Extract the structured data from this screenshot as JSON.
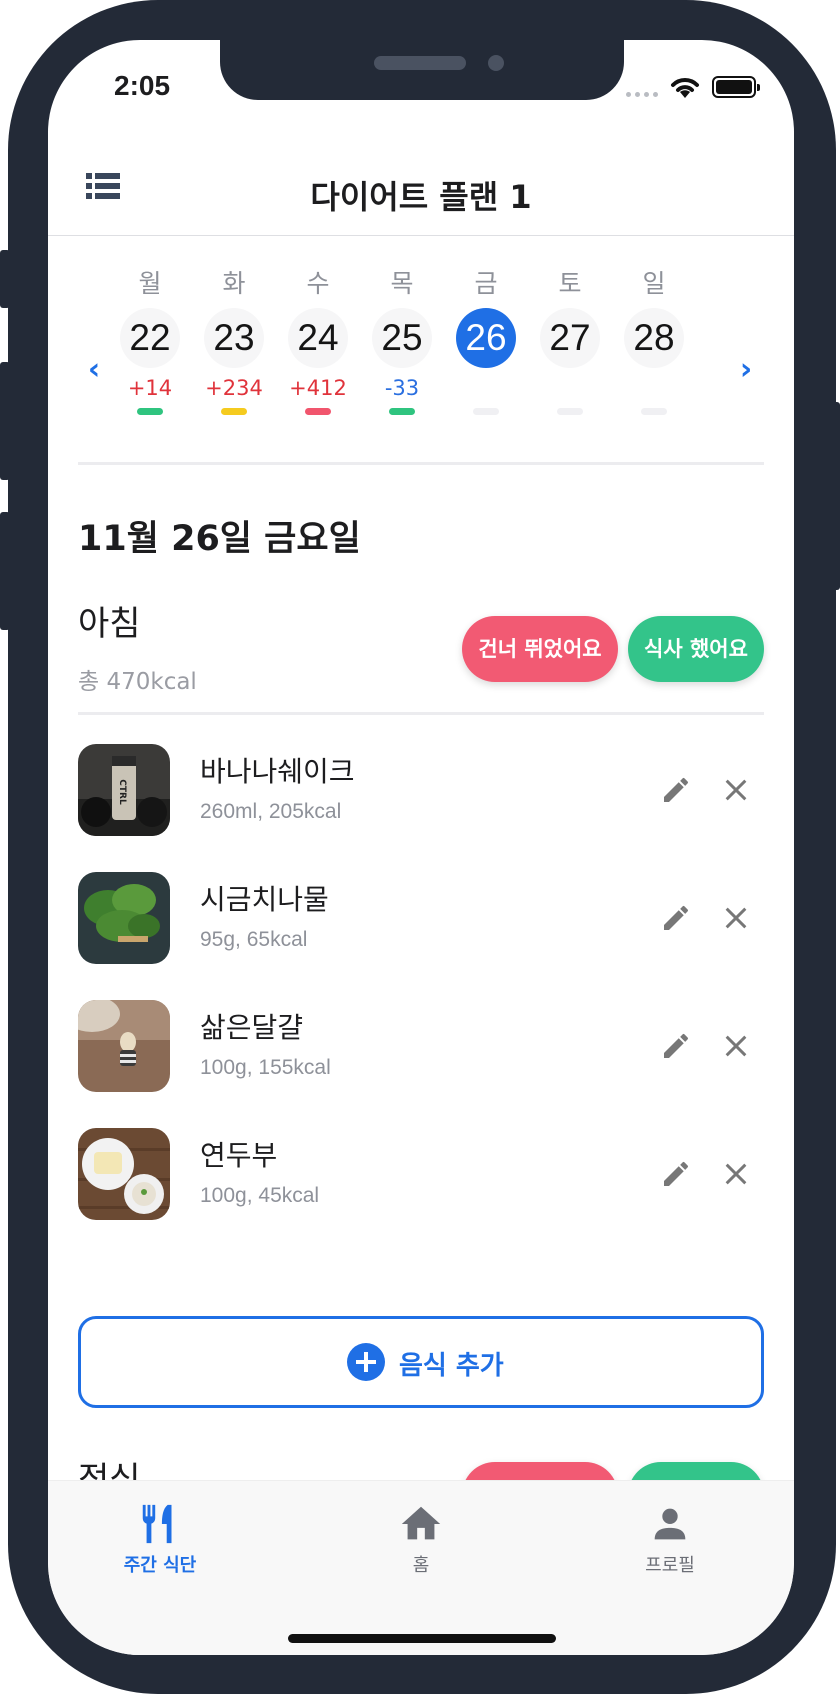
{
  "status": {
    "time": "2:05"
  },
  "header": {
    "title": "다이어트 플랜 1"
  },
  "week": {
    "days": [
      {
        "dow": "월",
        "date": "22",
        "delta": "+14",
        "bar_color": "#2fc47f"
      },
      {
        "dow": "화",
        "date": "23",
        "delta": "+234",
        "bar_color": "#f5cb1f"
      },
      {
        "dow": "수",
        "date": "24",
        "delta": "+412",
        "bar_color": "#f1556d"
      },
      {
        "dow": "목",
        "date": "25",
        "delta": "-33",
        "bar_color": "#2fc47f"
      },
      {
        "dow": "금",
        "date": "26",
        "delta": "",
        "bar_color": "#f0f0f3",
        "selected": true
      },
      {
        "dow": "토",
        "date": "27",
        "delta": "",
        "bar_color": "#f0f0f3"
      },
      {
        "dow": "일",
        "date": "28",
        "delta": "",
        "bar_color": "#f0f0f3"
      }
    ]
  },
  "selected_date": "11월 26일 금요일",
  "meal": {
    "name": "아침",
    "total": "총 470kcal",
    "skip_label": "건너 뛰었어요",
    "done_label": "식사 했어요",
    "foods": [
      {
        "name": "바나나쉐이크",
        "desc": "260ml, 205kcal",
        "image": "shaker-bottle"
      },
      {
        "name": "시금치나물",
        "desc": "95g, 65kcal",
        "image": "spinach"
      },
      {
        "name": "삶은달걀",
        "desc": "100g, 155kcal",
        "image": "boiled-egg"
      },
      {
        "name": "연두부",
        "desc": "100g, 45kcal",
        "image": "soft-tofu"
      }
    ]
  },
  "add_food_label": "음식 추가",
  "next_meal": {
    "name": "점심"
  },
  "tabs": [
    {
      "label": "주간 식단",
      "icon": "fork-knife-icon",
      "active": true
    },
    {
      "label": "홈",
      "icon": "home-icon",
      "active": false
    },
    {
      "label": "프로필",
      "icon": "person-icon",
      "active": false
    }
  ],
  "colors": {
    "accent": "#1f6fe5",
    "skip": "#f25a73",
    "done": "#33c48a",
    "positive_delta": "#e0333b",
    "negative_delta": "#2a6fe0"
  }
}
